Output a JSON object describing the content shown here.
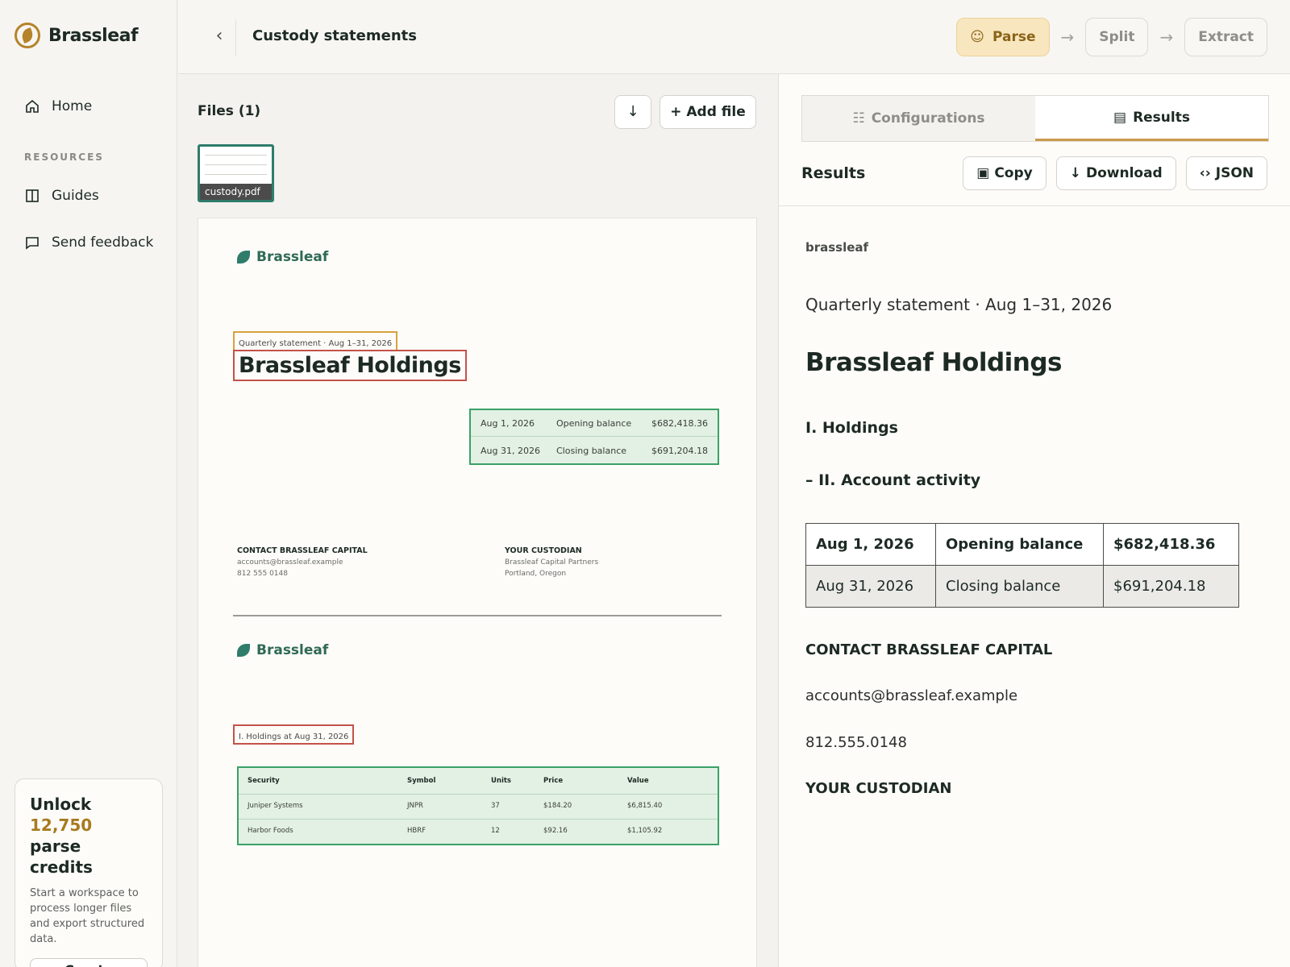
{
  "brand": {
    "name": "Brassleaf"
  },
  "sidebar": {
    "home": "Home",
    "resources_heading": "RESOURCES",
    "guides": "Guides",
    "feedback": "Send feedback",
    "promo": {
      "title_prefix": "Unlock ",
      "credits": "12,750",
      "title_suffix": "parse credits",
      "text": "Start a workspace to process longer files and export structured data.",
      "button": "Create workspace →"
    }
  },
  "header": {
    "back": "‹",
    "title": "Custody statements",
    "steps": [
      {
        "label": "Parse",
        "active": true
      },
      {
        "label": "Split",
        "active": false
      },
      {
        "label": "Extract",
        "active": false
      }
    ],
    "arrow": "→"
  },
  "files": {
    "heading": "Files (1)",
    "download_icon": "↓",
    "add_file": "+ Add file",
    "thumbnail_name": "custody.pdf"
  },
  "document": {
    "brand": "Brassleaf",
    "statement_label": "Quarterly statement · Aug 1–31, 2026",
    "title": "Brassleaf Holdings",
    "balances": [
      {
        "date": "Aug 1, 2026",
        "label": "Opening balance",
        "amount": "$682,418.36"
      },
      {
        "date": "Aug 31, 2026",
        "label": "Closing balance",
        "amount": "$691,204.18"
      }
    ],
    "contact": {
      "heading": "CONTACT BRASSLEAF CAPITAL",
      "email": "accounts@brassleaf.example",
      "phone": "812 555 0148"
    },
    "custodian": {
      "heading": "YOUR CUSTODIAN",
      "name": "Brassleaf Capital Partners",
      "location": "Portland, Oregon"
    },
    "brand2": "Brassleaf",
    "holdings_label": "I. Holdings at Aug 31, 2026",
    "holdings_table": {
      "headers": [
        "Security",
        "Symbol",
        "Units",
        "Price",
        "Value"
      ],
      "rows": [
        [
          "Juniper Systems",
          "JNPR",
          "37",
          "$184.20",
          "$6,815.40"
        ],
        [
          "Harbor Foods",
          "HBRF",
          "12",
          "$92.16",
          "$1,105.92"
        ]
      ]
    }
  },
  "results": {
    "tabs": {
      "configurations": "Configurations",
      "results": "Results"
    },
    "heading": "Results",
    "buttons": {
      "copy": "Copy",
      "download": "Download",
      "json": "JSON"
    },
    "content": {
      "brand": "brassleaf",
      "subtitle": "Quarterly statement · Aug 1–31, 2026",
      "title": "Brassleaf Holdings",
      "section1": "I. Holdings",
      "section2": "– II. Account activity",
      "table": [
        [
          "Aug 1, 2026",
          "Opening balance",
          "$682,418.36"
        ],
        [
          "Aug 31, 2026",
          "Closing balance",
          "$691,204.18"
        ]
      ],
      "contact_heading": "CONTACT BRASSLEAF CAPITAL",
      "email": "accounts@brassleaf.example",
      "phone": "812.555.0148",
      "custodian_heading": "YOUR CUSTODIAN"
    }
  },
  "colors": {
    "accent": "#b5832a",
    "active_step_bg": "#f8e6bf",
    "green_highlight": "#3aa166",
    "red_highlight": "#c3524a",
    "orange_highlight": "#d9a23f"
  }
}
